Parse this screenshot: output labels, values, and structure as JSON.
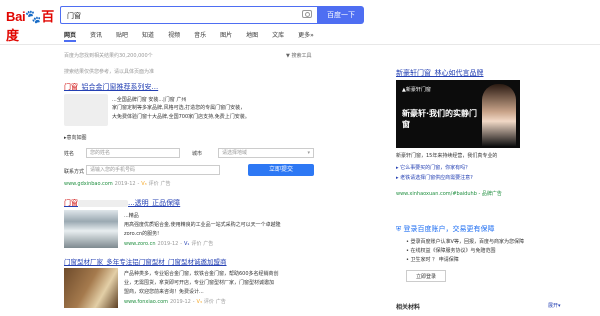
{
  "header": {
    "logo_text_1": "Bai",
    "logo_text_2": "百度",
    "search_value": "门窗",
    "search_button": "百度一下"
  },
  "tabs": [
    {
      "label": "网页"
    },
    {
      "label": "资讯"
    },
    {
      "label": "贴吧"
    },
    {
      "label": "知道"
    },
    {
      "label": "视频"
    },
    {
      "label": "音乐"
    },
    {
      "label": "图片"
    },
    {
      "label": "地图"
    },
    {
      "label": "文库"
    },
    {
      "label": "更多»"
    }
  ],
  "result_stats": "百度为您找到相关结果约30,200,000个",
  "search_tools": "搜索工具",
  "notice": "搜索结果仅供您参考，请以具体页面为准",
  "results": [
    {
      "title_prefix": "门窗",
      "title_rest": "_铝合金门窗推荐系列安...",
      "desc1": "...全国品牌门窗 安装...|门窗 广州",
      "desc2": "家门窗定制等多家品牌,风格可选,打造您的专属门窗门安装，",
      "desc3": "大免费体验门窗十大品牌,全国700家门店支持,免费上门安装。",
      "more_label": "▸意向如图",
      "form_name_label": "姓名",
      "form_name_placeholder": "您的姓名",
      "form_city_label": "城市",
      "form_city_placeholder": "请选择地域",
      "form_phone_label": "联系方式",
      "form_phone_placeholder": "请输入您的手机号码",
      "form_submit": "立即提交",
      "url": "www.gdxinbao.com",
      "date": "2019-12",
      "v": "V₃",
      "eval": "评价",
      "ad": "广告"
    },
    {
      "title_prefix": "门窗",
      "title_rest": "...透明_正品保障",
      "desc1": "...精品",
      "desc2": "用高强度优质铝合金,使用精良的工业品一站式采购之可以天一个卓越隆",
      "desc3": "zoro.cn的服务!",
      "url": "www.zoro.cn",
      "date": "2019-12",
      "v": "V₁",
      "eval": "评价",
      "ad": "广告"
    },
    {
      "title": "门窗型材厂家_多年专注铝门窗型材_门窗型材诚邀加盟商",
      "desc1": "产品种类多，专业铝合金门窗，软铁合金门窗，帮助600多名经销商创",
      "desc2": "业，无需囤货，拿货即可开店，专业门窗型材厂家，门窗型材诚邀加",
      "desc3": "盟商，欢迎您前来咨询！免费设计...",
      "url": "www.fonxiao.com",
      "date": "2019-12",
      "v": "V₃",
      "eval": "评价",
      "ad": "广告"
    }
  ],
  "sidebar": {
    "ad_title": "新豪轩门窗_林心如代言品牌",
    "ad_logo": "▲新豪轩门窗",
    "ad_slogan": "新豪轩·我们的实静门窗",
    "ad_desc": "新豪轩门窗，15年来持续经营，我们真专业的",
    "link1": "▸ 它么事要买的门窗，你家有吗？",
    "link2": "▸ 老铁请选择门窗供应商需要注意?",
    "url": "www.xinhaoxuan.com/#baiduhb - 品牌广告",
    "account_title": "登录百度账户，交易更有保障",
    "account_line1": "• 登录百度账户认准V等，回报，百度与商家为您保障",
    "account_line2": "• 在线权益《保障服务协议》与免赔范围",
    "account_line3": "• 卫生家时 ？ 申请保障",
    "login_button": "立即登录",
    "related_label": "相关材料",
    "expand": "展开"
  }
}
